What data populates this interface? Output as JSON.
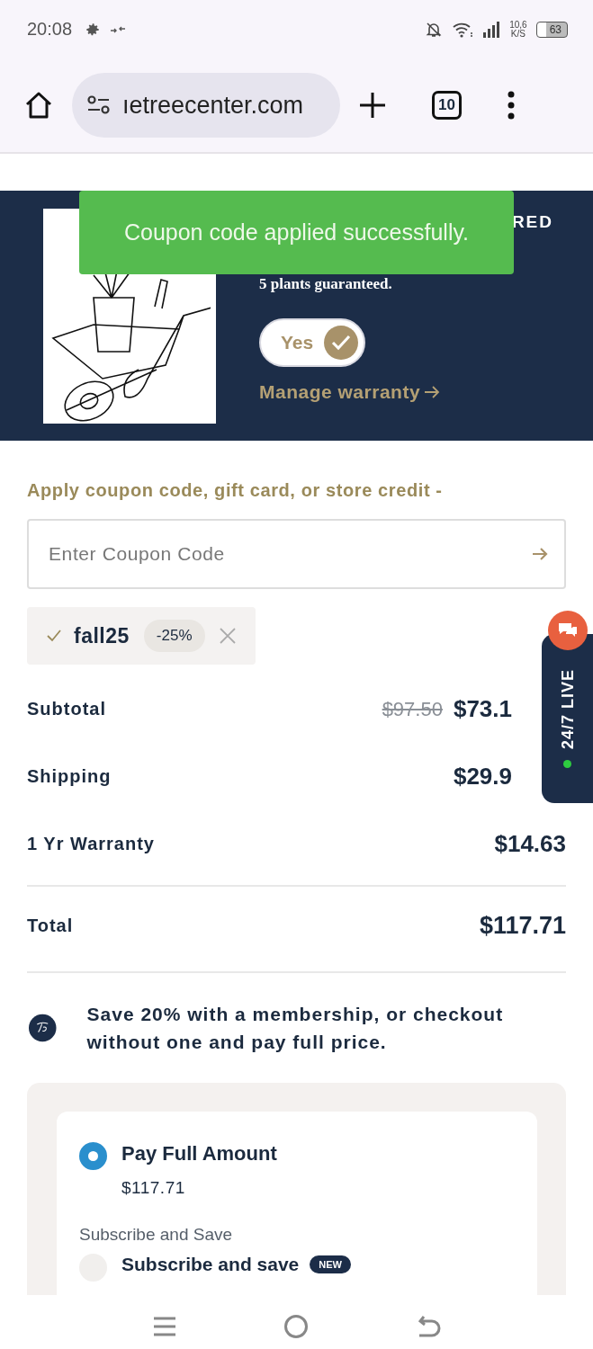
{
  "status_bar": {
    "time": "20:08",
    "net_speed": "10,6",
    "net_unit": "K/S",
    "battery": "63"
  },
  "browser": {
    "url": "ıetreecenter.com",
    "tab_count": "10"
  },
  "toast": {
    "message": "Coupon code applied successfully."
  },
  "warranty": {
    "heading": "RED",
    "subtitle": "5 plants guaranteed.",
    "toggle_label": "Yes",
    "toggle_on": true,
    "link": "Manage warranty"
  },
  "coupon": {
    "heading": "Apply coupon code, gift card, or store credit -",
    "placeholder": "Enter Coupon Code",
    "applied": {
      "code": "fall25",
      "discount": "-25%"
    }
  },
  "summary": [
    {
      "label": "Subtotal",
      "old_price": "$97.50",
      "price": "$73.1"
    },
    {
      "label": "Shipping",
      "price": "$29.9"
    },
    {
      "label": "1 Yr Warranty",
      "price": "$14.63"
    }
  ],
  "total": {
    "label": "Total",
    "price": "$117.71"
  },
  "membership": {
    "text": "Save 20% with a membership, or checkout without one and pay full price."
  },
  "payment_options": [
    {
      "title": "Pay Full Amount",
      "price": "$117.71",
      "selected": true
    },
    {
      "group_label": "Subscribe and Save",
      "title": "Subscribe and save",
      "badge": "NEW",
      "selected": false
    }
  ],
  "live_chat": {
    "label": "24/7 LIVE",
    "online": true
  }
}
